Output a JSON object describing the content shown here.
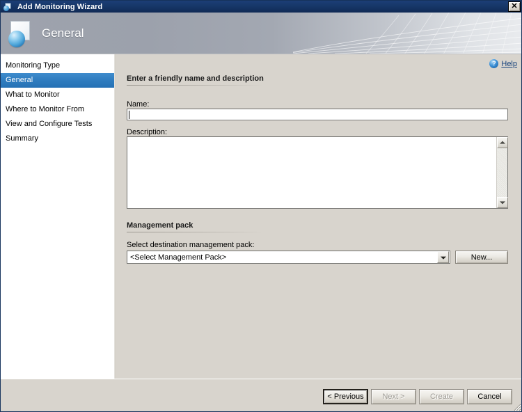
{
  "window": {
    "title": "Add Monitoring Wizard",
    "title_icon": "wizard-page-sphere-icon",
    "close_label": "✕"
  },
  "header": {
    "title": "General",
    "icon": "page-sphere-icon"
  },
  "help": {
    "label": "Help",
    "icon": "help-question-icon"
  },
  "sidebar": {
    "items": [
      {
        "label": "Monitoring Type",
        "selected": false
      },
      {
        "label": "General",
        "selected": true
      },
      {
        "label": "What to Monitor",
        "selected": false
      },
      {
        "label": "Where to Monitor From",
        "selected": false
      },
      {
        "label": "View and Configure Tests",
        "selected": false
      },
      {
        "label": "Summary",
        "selected": false
      }
    ]
  },
  "main": {
    "section_name": "Enter a friendly name and description",
    "name_label": "Name:",
    "name_value": "",
    "name_placeholder": "",
    "description_label": "Description:",
    "description_value": "",
    "description_placeholder": "",
    "mp_section": "Management pack",
    "mp_label": "Select destination management pack:",
    "mp_value": "<Select Management Pack>",
    "mp_new_button": "New..."
  },
  "footer": {
    "previous": "< Previous",
    "next": "Next >",
    "create": "Create",
    "cancel": "Cancel"
  },
  "colors": {
    "titlebar": "#163667",
    "selection": "#2f7cbf",
    "dialog_face": "#d8d4cd",
    "link": "#16427c"
  }
}
